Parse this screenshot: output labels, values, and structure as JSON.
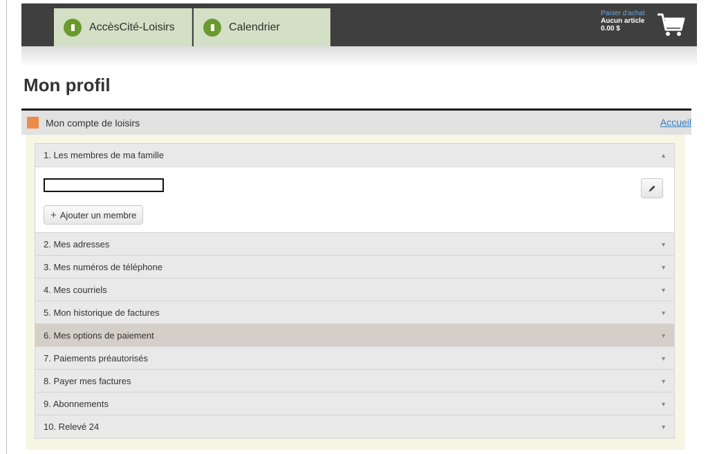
{
  "nav": {
    "tabs": [
      {
        "label": "AccèsCité-Loisirs"
      },
      {
        "label": "Calendrier"
      }
    ],
    "cart": {
      "title": "Panier d'achat",
      "items": "Aucun article",
      "total": "0.00 $",
      "icon": "shopping-cart-icon"
    }
  },
  "page": {
    "title": "Mon profil"
  },
  "account": {
    "title": "Mon compte de loisirs",
    "home_link": "Accueil"
  },
  "sections": [
    {
      "label": "1. Les membres de ma famille",
      "expanded": true
    },
    {
      "label": "2. Mes adresses"
    },
    {
      "label": "3. Mes numéros de téléphone"
    },
    {
      "label": "4. Mes courriels"
    },
    {
      "label": "5. Mon historique de factures"
    },
    {
      "label": "6. Mes options de paiement"
    },
    {
      "label": "7. Paiements préautorisés"
    },
    {
      "label": "8. Payer mes factures"
    },
    {
      "label": "9. Abonnements"
    },
    {
      "label": "10. Relevé 24"
    }
  ],
  "family": {
    "member_value": "",
    "add_member_label": "Ajouter un membre",
    "edit_icon": "pencil-icon"
  },
  "icons": {
    "expand_up": "▲",
    "expand_down": "▼"
  },
  "colors": {
    "topbar": "#3f3f3f",
    "tab_bg": "#d3e0c5",
    "logo_green": "#6a9a2e",
    "account_square": "#ec8b4a",
    "link": "#2f7cc3",
    "highlight_row": "#d5cfc9"
  }
}
